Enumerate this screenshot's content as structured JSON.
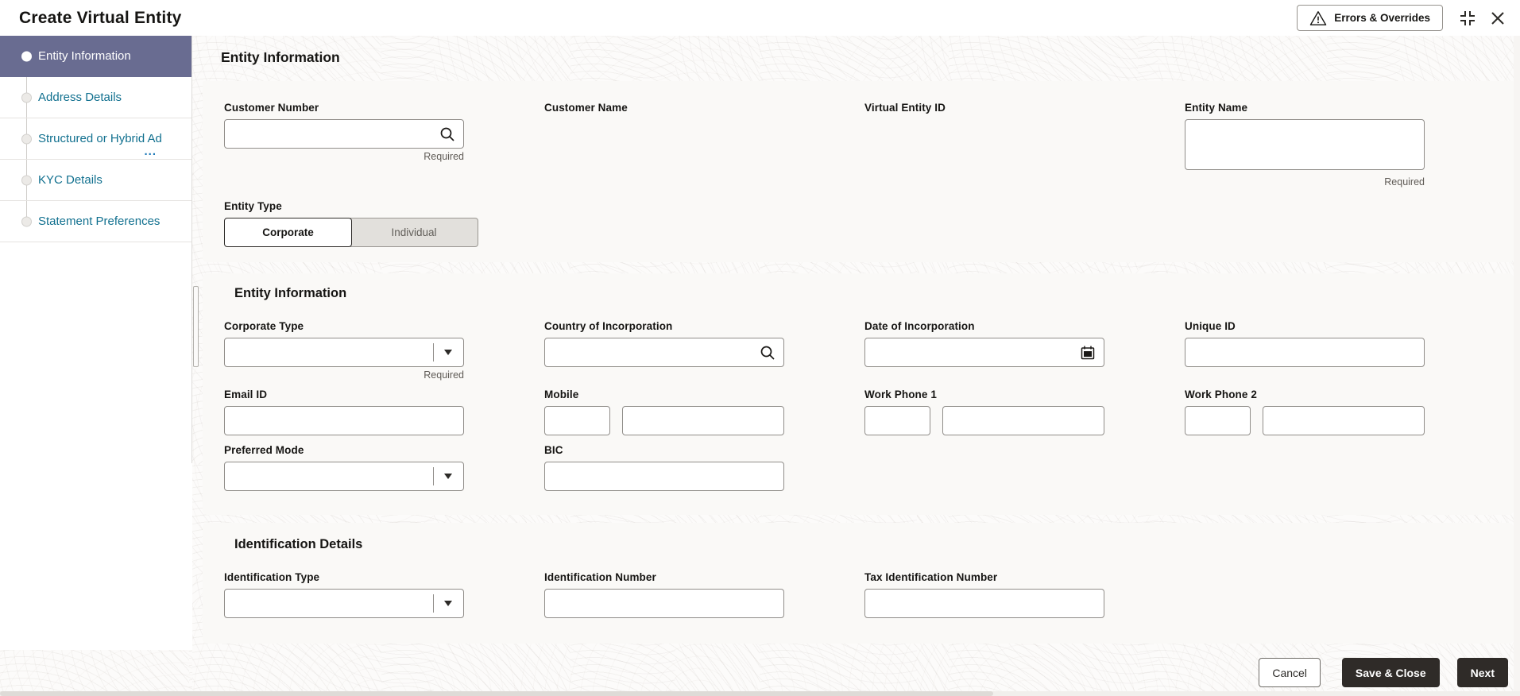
{
  "colors": {
    "accent_teal": "#11708f",
    "active_step_bg": "#696c91",
    "dark_button_bg": "#2f2b28",
    "panel_bg": "#faf9f7",
    "input_border": "#908d89"
  },
  "header": {
    "title": "Create Virtual Entity",
    "errors_overrides_label": "Errors & Overrides",
    "icons": [
      "warning-triangle-icon",
      "collapse-icon",
      "close-icon"
    ]
  },
  "steps": {
    "items": [
      {
        "label": "Entity Information",
        "active": true
      },
      {
        "label": "Address Details",
        "active": false
      },
      {
        "label": "Structured or Hybrid Ad",
        "ellipsis": "...",
        "active": false
      },
      {
        "label": "KYC Details",
        "active": false
      },
      {
        "label": "Statement Preferences",
        "active": false
      }
    ]
  },
  "main": {
    "heading": "Entity Information",
    "card_general": {
      "customer_number": {
        "label": "Customer Number",
        "value": "",
        "required": "Required",
        "icon": "search-icon"
      },
      "customer_name": {
        "label": "Customer Name",
        "value": ""
      },
      "virtual_entity_id": {
        "label": "Virtual Entity ID",
        "value": ""
      },
      "entity_name": {
        "label": "Entity Name",
        "value": "",
        "required": "Required"
      },
      "entity_type": {
        "label": "Entity Type",
        "options": [
          "Corporate",
          "Individual"
        ],
        "selected": "Corporate"
      }
    },
    "card_entity_info": {
      "heading": "Entity Information",
      "corporate_type": {
        "label": "Corporate Type",
        "value": "",
        "required": "Required",
        "icon": "chevron-down-icon"
      },
      "country_of_incorporation": {
        "label": "Country of Incorporation",
        "value": "",
        "icon": "search-icon"
      },
      "date_of_incorporation": {
        "label": "Date of Incorporation",
        "value": "",
        "icon": "calendar-icon"
      },
      "unique_id": {
        "label": "Unique ID",
        "value": ""
      },
      "email_id": {
        "label": "Email ID",
        "value": ""
      },
      "mobile": {
        "label": "Mobile",
        "code_value": "",
        "number_value": ""
      },
      "work_phone_1": {
        "label": "Work Phone 1",
        "code_value": "",
        "number_value": ""
      },
      "work_phone_2": {
        "label": "Work Phone 2",
        "code_value": "",
        "number_value": ""
      },
      "preferred_mode": {
        "label": "Preferred Mode",
        "value": "",
        "icon": "chevron-down-icon"
      },
      "bic": {
        "label": "BIC",
        "value": ""
      }
    },
    "card_identification": {
      "heading": "Identification Details",
      "identification_type": {
        "label": "Identification Type",
        "value": "",
        "icon": "chevron-down-icon"
      },
      "identification_number": {
        "label": "Identification Number",
        "value": ""
      },
      "tax_identification_number": {
        "label": "Tax Identification Number",
        "value": ""
      }
    }
  },
  "footer": {
    "cancel_label": "Cancel",
    "save_close_label": "Save & Close",
    "next_label": "Next"
  }
}
